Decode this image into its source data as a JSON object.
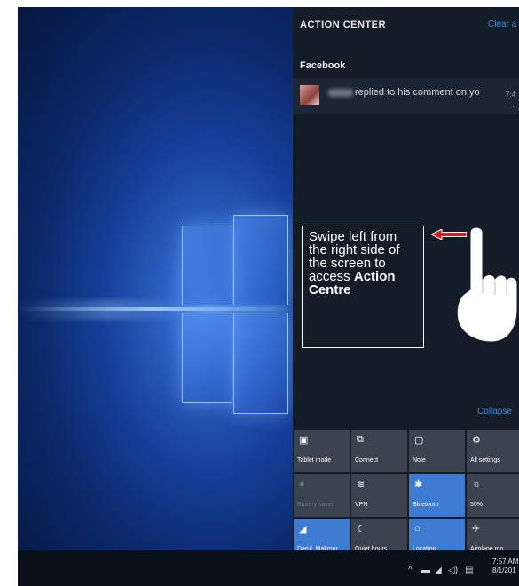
{
  "action_center": {
    "title": "ACTION CENTER",
    "clear_all": "Clear a",
    "app_name": "Facebook",
    "notification": {
      "text": "replied to his comment on yo",
      "time": "7:4"
    },
    "collapse": "Collapse"
  },
  "callout": {
    "text_plain": "Swipe left from the right  side of the screen to access ",
    "text_bold": "Action Centre"
  },
  "tiles": [
    {
      "label": "Tablet mode",
      "icon": "tablet-mode-icon",
      "state": "off"
    },
    {
      "label": "Connect",
      "icon": "connect-icon",
      "state": "off"
    },
    {
      "label": "Note",
      "icon": "note-icon",
      "state": "off"
    },
    {
      "label": "All settings",
      "icon": "settings-icon",
      "state": "off"
    },
    {
      "label": "Battery saver",
      "icon": "battery-saver-icon",
      "state": "disabled"
    },
    {
      "label": "VPN",
      "icon": "vpn-icon",
      "state": "off"
    },
    {
      "label": "Bluetooth",
      "icon": "bluetooth-icon",
      "state": "on"
    },
    {
      "label": "55%",
      "icon": "brightness-icon",
      "state": "off"
    },
    {
      "label": "Darul_Makmur",
      "icon": "wifi-icon",
      "state": "on"
    },
    {
      "label": "Quiet hours",
      "icon": "quiet-hours-icon",
      "state": "off"
    },
    {
      "label": "Location",
      "icon": "location-icon",
      "state": "on"
    },
    {
      "label": "Airplane mo",
      "icon": "airplane-mode-icon",
      "state": "off"
    }
  ],
  "taskbar": {
    "time": "7:57 AM",
    "date": "8/1/201"
  },
  "colors": {
    "accent": "#3d7bd3",
    "link": "#3b8de0",
    "panel": "#141c28",
    "tile": "#3c4350",
    "arrow": "#d21e1e"
  }
}
